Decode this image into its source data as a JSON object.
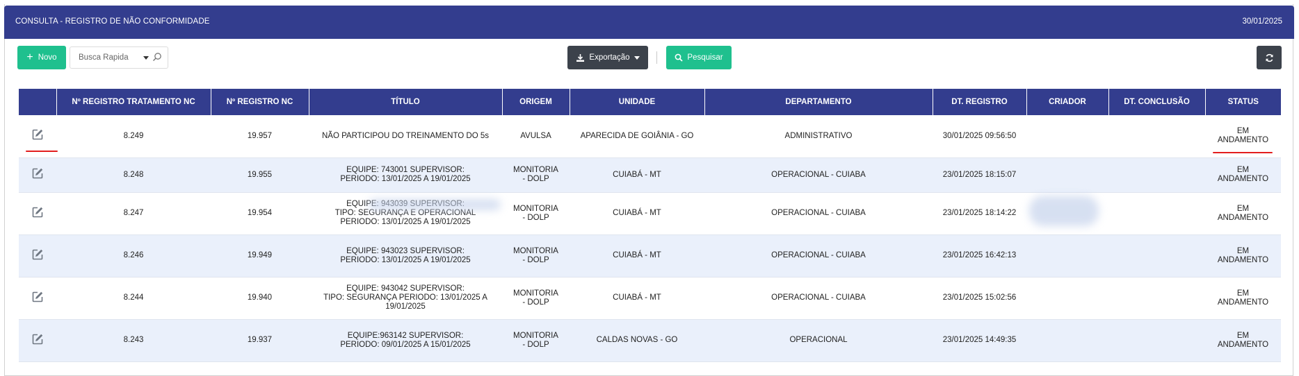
{
  "header": {
    "title": "CONSULTA - REGISTRO DE NÃO CONFORMIDADE",
    "date": "30/01/2025"
  },
  "toolbar": {
    "new_label": "Novo",
    "quick_search_placeholder": "Busca Rapida",
    "export_label": "Exportação",
    "search_label": "Pesquisar"
  },
  "table": {
    "columns": [
      "",
      "Nº REGISTRO TRATAMENTO NC",
      "Nº REGISTRO NC",
      "TÍTULO",
      "ORIGEM",
      "UNIDADE",
      "DEPARTAMENTO",
      "DT. REGISTRO",
      "CRIADOR",
      "DT. CONCLUSÃO",
      "STATUS"
    ],
    "rows": [
      {
        "tratamento": "8.249",
        "registro": "19.957",
        "titulo": [
          "NÃO PARTICIPOU DO TREINAMENTO DO 5s"
        ],
        "origem": [
          "AVULSA"
        ],
        "unidade": "APARECIDA DE GOIÂNIA - GO",
        "departamento": "ADMINISTRATIVO",
        "dt_registro": "30/01/2025 09:56:50",
        "criador": "",
        "dt_conclusao": "",
        "status": [
          "EM",
          "ANDAMENTO"
        ]
      },
      {
        "tratamento": "8.248",
        "registro": "19.955",
        "titulo": [
          "EQUIPE: 743001 SUPERVISOR:",
          "PERIODO: 13/01/2025 A 19/01/2025"
        ],
        "origem": [
          "MONITORIA",
          "- DOLP"
        ],
        "unidade": "CUIABÁ - MT",
        "departamento": "OPERACIONAL - CUIABA",
        "dt_registro": "23/01/2025 18:15:07",
        "criador": "",
        "dt_conclusao": "",
        "status": [
          "EM",
          "ANDAMENTO"
        ]
      },
      {
        "tratamento": "8.247",
        "registro": "19.954",
        "titulo": [
          "EQUIPE: 943039 SUPERVISOR:",
          "TIPO: SEGURANÇA E OPERACIONAL",
          "PERIODO: 13/01/2025 A 19/01/2025"
        ],
        "origem": [
          "MONITORIA",
          "- DOLP"
        ],
        "unidade": "CUIABÁ - MT",
        "departamento": "OPERACIONAL - CUIABA",
        "dt_registro": "23/01/2025 18:14:22",
        "criador": "",
        "dt_conclusao": "",
        "status": [
          "EM",
          "ANDAMENTO"
        ]
      },
      {
        "tratamento": "8.246",
        "registro": "19.949",
        "titulo": [
          "EQUIPE: 943023 SUPERVISOR:",
          "PERIODO: 13/01/2025 A 19/01/2025"
        ],
        "origem": [
          "MONITORIA",
          "- DOLP"
        ],
        "unidade": "CUIABÁ - MT",
        "departamento": "OPERACIONAL - CUIABA",
        "dt_registro": "23/01/2025 16:42:13",
        "criador": "",
        "dt_conclusao": "",
        "status": [
          "EM",
          "ANDAMENTO"
        ]
      },
      {
        "tratamento": "8.244",
        "registro": "19.940",
        "titulo": [
          "EQUIPE: 943042 SUPERVISOR:",
          "TIPO: SEGURANÇA PERIODO: 13/01/2025 A",
          "19/01/2025"
        ],
        "origem": [
          "MONITORIA",
          "- DOLP"
        ],
        "unidade": "CUIABÁ - MT",
        "departamento": "OPERACIONAL - CUIABA",
        "dt_registro": "23/01/2025 15:02:56",
        "criador": "",
        "dt_conclusao": "",
        "status": [
          "EM",
          "ANDAMENTO"
        ]
      },
      {
        "tratamento": "8.243",
        "registro": "19.937",
        "titulo": [
          "EQUIPE:963142 SUPERVISOR:",
          "PERIODO: 09/01/2025 A 15/01/2025"
        ],
        "origem": [
          "MONITORIA",
          "- DOLP"
        ],
        "unidade": "CALDAS NOVAS - GO",
        "departamento": "OPERACIONAL",
        "dt_registro": "23/01/2025 14:49:35",
        "criador": "",
        "dt_conclusao": "",
        "status": [
          "EM",
          "ANDAMENTO"
        ]
      }
    ]
  },
  "icons": {
    "new": "plus-icon",
    "quick_search": "magnifier-icon",
    "export": "download-icon",
    "search": "search-icon",
    "refresh": "refresh-icon",
    "row_edit": "edit-icon"
  },
  "colors": {
    "header_bg": "#333d8e",
    "primary_green": "#1fc08e",
    "dark_button": "#3c424b",
    "row_alt": "#eaf0fb",
    "annotation_red": "#e21d1d"
  }
}
